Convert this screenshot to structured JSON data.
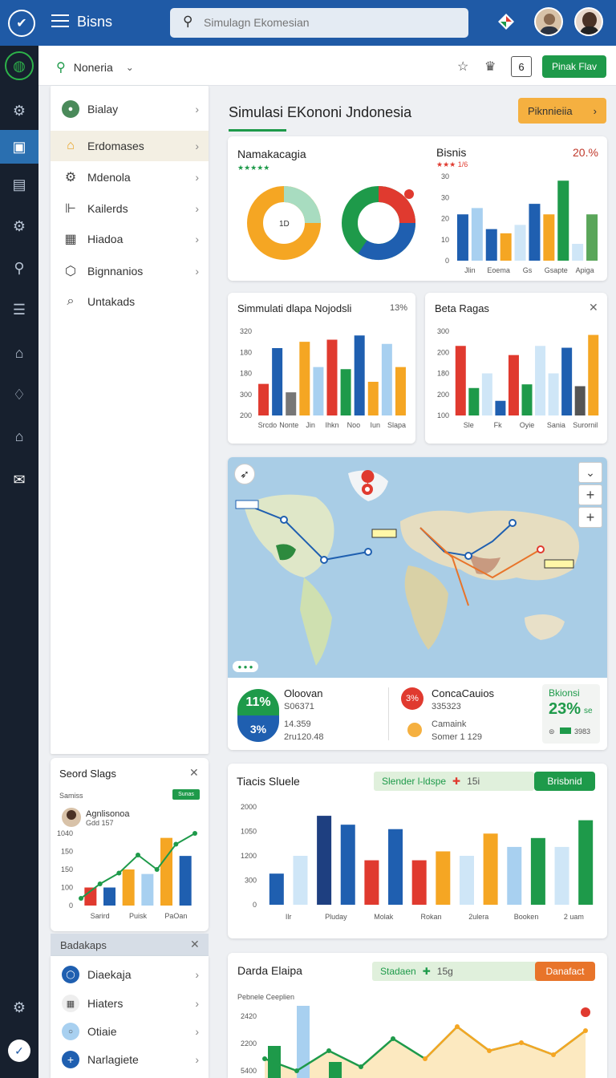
{
  "header": {
    "app_name": "Bisns",
    "search_placeholder": "Simulagn Ekomesian"
  },
  "subheader": {
    "dropdown_label": "Noneria",
    "badge": "6",
    "action_label": "Pinak Flav"
  },
  "sidebar_nav": [
    {
      "label": "Bialay",
      "icon": "avatar-icon"
    },
    {
      "label": "Erdomases",
      "icon": "folder-icon"
    },
    {
      "label": "Mdenola",
      "icon": "gear-icon"
    },
    {
      "label": "Kailerds",
      "icon": "chart-icon"
    },
    {
      "label": "Hiadoa",
      "icon": "grid-icon"
    },
    {
      "label": "Bignnanios",
      "icon": "tag-icon"
    },
    {
      "label": "Untakads",
      "icon": "link-icon"
    }
  ],
  "page": {
    "title": "Simulasi EKononi Jndonesia",
    "action_label": "Piknnieiia"
  },
  "colors": {
    "blue": "#1f5fb0",
    "lightblue": "#a8d0f0",
    "orange": "#f5a623",
    "red": "#e03a2f",
    "green": "#1e9a4a",
    "paleblue": "#cfe6f7",
    "palegreen": "#e0f0dc"
  },
  "card_donuts": {
    "title": "Namakacagia",
    "rating": "★★★★★",
    "donut1_label": "1D"
  },
  "card_bisnis": {
    "title": "Bisnis",
    "rating": "★★★ 1/6",
    "value": "20.%",
    "chart_data": {
      "type": "bar",
      "y_ticks": [
        0,
        10,
        20,
        30,
        30
      ],
      "categories": [
        "Jlin",
        "Eoema",
        "Gs",
        "Gsapte",
        "Apiga"
      ],
      "series": [
        {
          "values": [
            22,
            15,
            17,
            22,
            8
          ]
        },
        {
          "values": [
            25,
            13,
            27,
            38,
            22
          ]
        }
      ]
    }
  },
  "card_sim": {
    "title": "Simmulati dlapa Nojodsli",
    "value": "13%",
    "chart_data": {
      "type": "bar",
      "y_ticks": [
        200,
        300,
        180,
        180,
        320
      ],
      "categories": [
        "Srcdo",
        "Nonte",
        "Jin",
        "Ihkn",
        "Noo",
        "Iun",
        "Slapa"
      ],
      "values": [
        75,
        160,
        55,
        175,
        115,
        180,
        110,
        190,
        80,
        170,
        115
      ]
    }
  },
  "card_beta": {
    "title": "Beta Ragas",
    "chart_data": {
      "type": "bar",
      "y_ticks": [
        100,
        200,
        180,
        200,
        300
      ],
      "categories": [
        "Sle",
        "Fk",
        "Oyie",
        "Sania",
        "Surornil"
      ],
      "values": [
        190,
        75,
        115,
        40,
        165,
        85,
        190,
        115,
        185,
        80,
        220
      ]
    }
  },
  "map": {
    "zoom_in": "+",
    "zoom_out": "+"
  },
  "stats": [
    {
      "pct_top": "11%",
      "pct_bottom": "3%",
      "title": "Oloovan",
      "line1": "S06371",
      "line2": "14.359",
      "line3": "2ru120.48"
    },
    {
      "pct": "3%",
      "title": "ConcaCauios",
      "line1": "335323",
      "line2": "Camaink",
      "line3": "Somer 1 129"
    },
    {
      "title": "Bkionsi",
      "value": "23%",
      "suffix": "se",
      "foot": "3983"
    }
  ],
  "card_slage": {
    "title": "Seord Slags",
    "caption": "Samiss",
    "badge": "Sunas",
    "person_name": "Agnlisonoa",
    "person_sub": "Gdd 157",
    "chart_data": {
      "type": "bar",
      "y_ticks": [
        0,
        100,
        150,
        150,
        1040
      ],
      "categories": [
        "Sarird",
        "Puisk",
        "PaOan"
      ],
      "values": [
        20,
        20,
        40,
        35,
        75,
        55
      ],
      "line": [
        10,
        30,
        45,
        70,
        50,
        85,
        100
      ]
    }
  },
  "card_badakaps": {
    "title": "Badakaps",
    "items": [
      {
        "label": "Diaekaja"
      },
      {
        "label": "Hiaters"
      },
      {
        "label": "Otiaie"
      },
      {
        "label": "Narlagiete"
      }
    ]
  },
  "card_tiacis": {
    "title": "Tiacis Sluele",
    "filter_label": "Slender l-ldspe",
    "filter_value": "15i",
    "button_label": "Brisbnid",
    "chart_data": {
      "type": "bar",
      "y_ticks": [
        0,
        300,
        1200,
        1050,
        2000
      ],
      "categories": [
        "Ilr",
        "Pluday",
        "Molak",
        "Rokan",
        "2ulera",
        "Booken",
        "2 uam"
      ],
      "values": [
        35,
        55,
        100,
        90,
        50,
        85,
        50,
        60,
        55,
        80,
        65,
        75,
        65,
        95
      ]
    }
  },
  "card_darda": {
    "title": "Darda Elaipa",
    "caption": "Pebnele Ceeplien",
    "filter_label": "Stadaen",
    "filter_value": "15g",
    "button_label": "Danafact",
    "chart_data": {
      "type": "line",
      "y_ticks": [
        2420,
        2200,
        5400
      ],
      "line": [
        20,
        5,
        30,
        10,
        45,
        20,
        60,
        30,
        40,
        25,
        55
      ]
    }
  }
}
